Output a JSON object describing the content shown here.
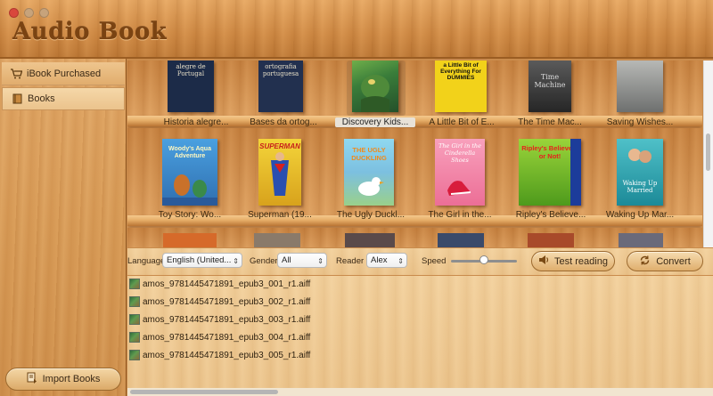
{
  "app": {
    "title": "Audio Book"
  },
  "sidebar": {
    "items": [
      {
        "label": "iBook Purchased",
        "icon": "cart-icon"
      },
      {
        "label": "Books",
        "icon": "book-icon"
      }
    ],
    "import_label": "Import Books"
  },
  "shelf": {
    "row1": [
      {
        "title": "Historia alegre...",
        "cover_text": "alegre de Portugal",
        "cover_bg": "#1c2b48"
      },
      {
        "title": "Bases da ortog...",
        "cover_text": "ortografia portuguesa",
        "cover_bg": "#22304f"
      },
      {
        "title": "Discovery Kids...",
        "cover_text": "",
        "cover_bg": "#3a7d3a",
        "selected": true
      },
      {
        "title": "A Little Bit of E...",
        "cover_text": "a Little Bit of Everything For DUMMIES",
        "cover_bg": "#f2d21a"
      },
      {
        "title": "The Time Mac...",
        "cover_text": "Time Machine",
        "cover_bg": "#3b3b3b"
      },
      {
        "title": "Saving Wishes...",
        "cover_text": "",
        "cover_bg": "#8a8c8c"
      }
    ],
    "row2": [
      {
        "title": "Toy Story:  Wo...",
        "cover_text": "Woody's Aqua Adventure",
        "cover_bg": "#3f8fd0"
      },
      {
        "title": "Superman (19...",
        "cover_text": "SUPERMAN",
        "cover_bg": "#e8c11c"
      },
      {
        "title": "The Ugly Duckl...",
        "cover_text": "THE UGLY DUCKLING",
        "cover_bg": "#6ec6e8"
      },
      {
        "title": "The Girl in the...",
        "cover_text": "The Girl in the Cinderella Shoes",
        "cover_bg": "#f07aa0"
      },
      {
        "title": "Ripley's Believe...",
        "cover_text": "Ripley's Believe It or Not!",
        "cover_bg": "#7ab82a"
      },
      {
        "title": "Waking Up Mar...",
        "cover_text": "Waking Up Married",
        "cover_bg": "#2a9aa8"
      }
    ]
  },
  "controls": {
    "language_label": "Language",
    "language_value": "English (United...",
    "gender_label": "Gender",
    "gender_value": "All",
    "reader_label": "Reader",
    "reader_value": "Alex",
    "speed_label": "Speed",
    "speed_value": 0.5,
    "test_label": "Test reading",
    "convert_label": "Convert"
  },
  "files": [
    "amos_9781445471891_epub3_001_r1.aiff",
    "amos_9781445471891_epub3_002_r1.aiff",
    "amos_9781445471891_epub3_003_r1.aiff",
    "amos_9781445471891_epub3_004_r1.aiff",
    "amos_9781445471891_epub3_005_r1.aiff"
  ]
}
